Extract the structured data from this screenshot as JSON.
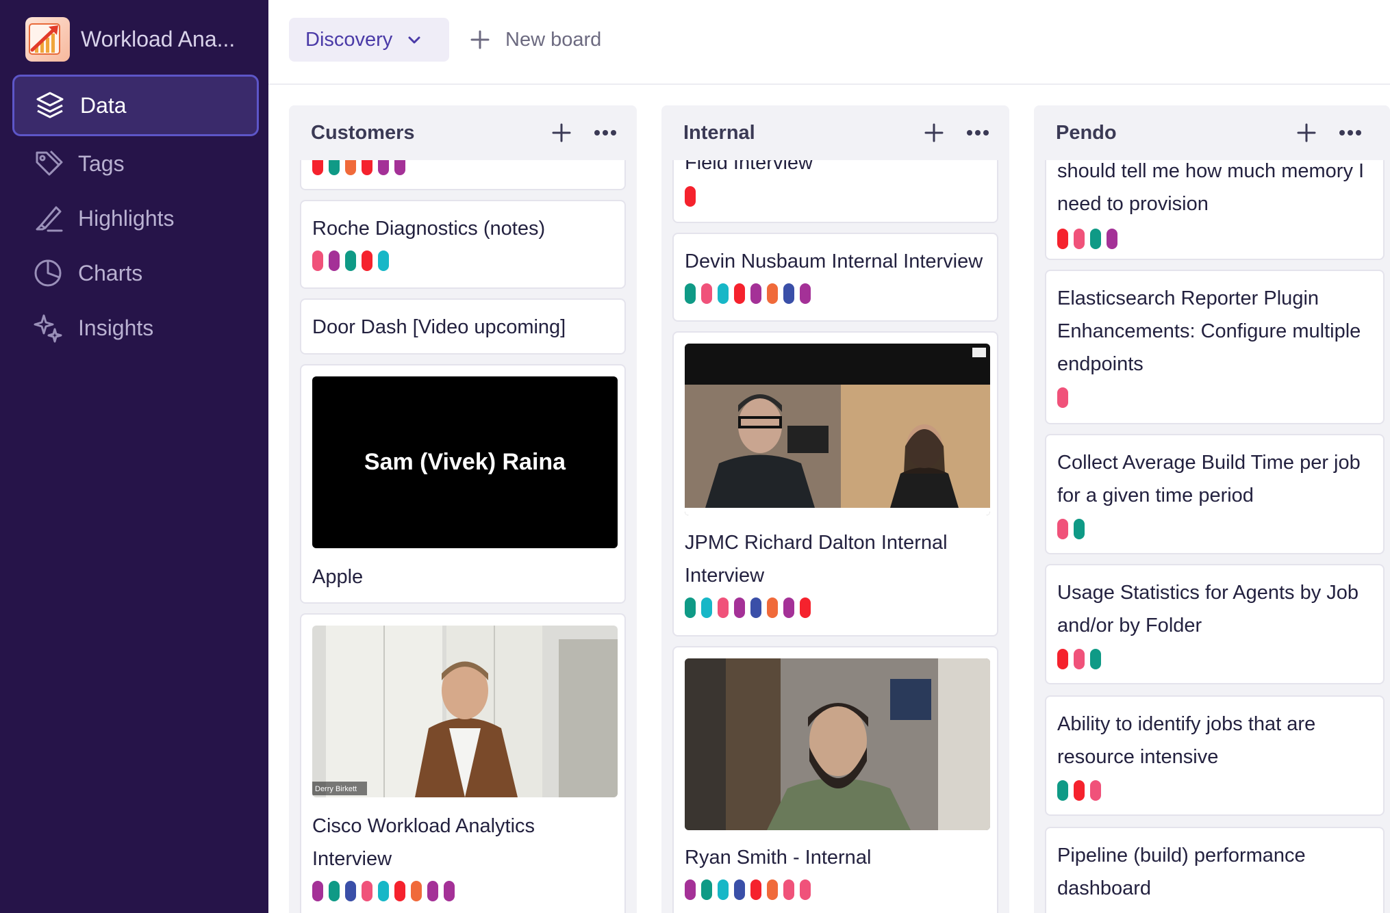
{
  "workspace": {
    "name": "Workload Ana..."
  },
  "nav": [
    {
      "label": "Data",
      "icon": "layers-icon",
      "active": true
    },
    {
      "label": "Tags",
      "icon": "tag-icon",
      "active": false
    },
    {
      "label": "Highlights",
      "icon": "highlighter-icon",
      "active": false
    },
    {
      "label": "Charts",
      "icon": "pie-chart-icon",
      "active": false
    },
    {
      "label": "Insights",
      "icon": "sparkles-icon",
      "active": false
    }
  ],
  "toolbar": {
    "board_label": "Discovery",
    "new_board_label": "New board"
  },
  "colors": {
    "red": "#f5222d",
    "pink": "#f0527a",
    "teal": "#0f9a86",
    "cyan": "#17b7c7",
    "purple": "#a43197",
    "orange": "#f06a3a",
    "navy": "#3a4fa8",
    "accent": "#4a3aa7",
    "sidebar": "#261449"
  },
  "columns": [
    {
      "title": "Customers",
      "cards": [
        {
          "title": "",
          "tags": [
            "red",
            "teal",
            "orange",
            "red",
            "purple",
            "purple"
          ]
        },
        {
          "title": "Roche Diagnostics (notes)",
          "tags": [
            "pink",
            "purple",
            "teal",
            "red",
            "cyan"
          ]
        },
        {
          "title": "Door Dash [Video upcoming]",
          "tags": []
        },
        {
          "title": "Apple",
          "thumb_text": "Sam (Vivek) Raina",
          "tags": []
        },
        {
          "title": "Cisco Workload Analytics Interview",
          "thumb_caption": "Derry Birkett",
          "tags": [
            "purple",
            "teal",
            "navy",
            "pink",
            "cyan",
            "red",
            "orange",
            "purple",
            "purple"
          ]
        }
      ]
    },
    {
      "title": "Internal",
      "cards": [
        {
          "title": "Field Interview",
          "tags": [
            "red"
          ]
        },
        {
          "title": "Devin Nusbaum Internal Interview",
          "tags": [
            "teal",
            "pink",
            "cyan",
            "red",
            "purple",
            "orange",
            "navy",
            "purple"
          ]
        },
        {
          "title": "JPMC Richard Dalton Internal Interview",
          "tags": [
            "teal",
            "cyan",
            "pink",
            "purple",
            "navy",
            "orange",
            "purple",
            "red"
          ]
        },
        {
          "title": "Ryan Smith - Internal",
          "tags": [
            "purple",
            "teal",
            "cyan",
            "navy",
            "red",
            "orange",
            "pink",
            "pink"
          ]
        }
      ]
    },
    {
      "title": "Pendo",
      "cards": [
        {
          "title": "should tell me how much memory I need to provision",
          "tags": [
            "red",
            "pink",
            "teal",
            "purple"
          ]
        },
        {
          "title": "Elasticsearch Reporter Plugin Enhancements: Configure multiple endpoints",
          "tags": [
            "pink"
          ]
        },
        {
          "title": "Collect Average Build Time per job for a given time period",
          "tags": [
            "pink",
            "teal"
          ]
        },
        {
          "title": "Usage Statistics for Agents by Job and/or by Folder",
          "tags": [
            "red",
            "pink",
            "teal"
          ]
        },
        {
          "title": "Ability to identify jobs that are resource intensive",
          "tags": [
            "teal",
            "red",
            "pink"
          ]
        },
        {
          "title": "Pipeline (build) performance dashboard",
          "tags": []
        }
      ]
    }
  ]
}
